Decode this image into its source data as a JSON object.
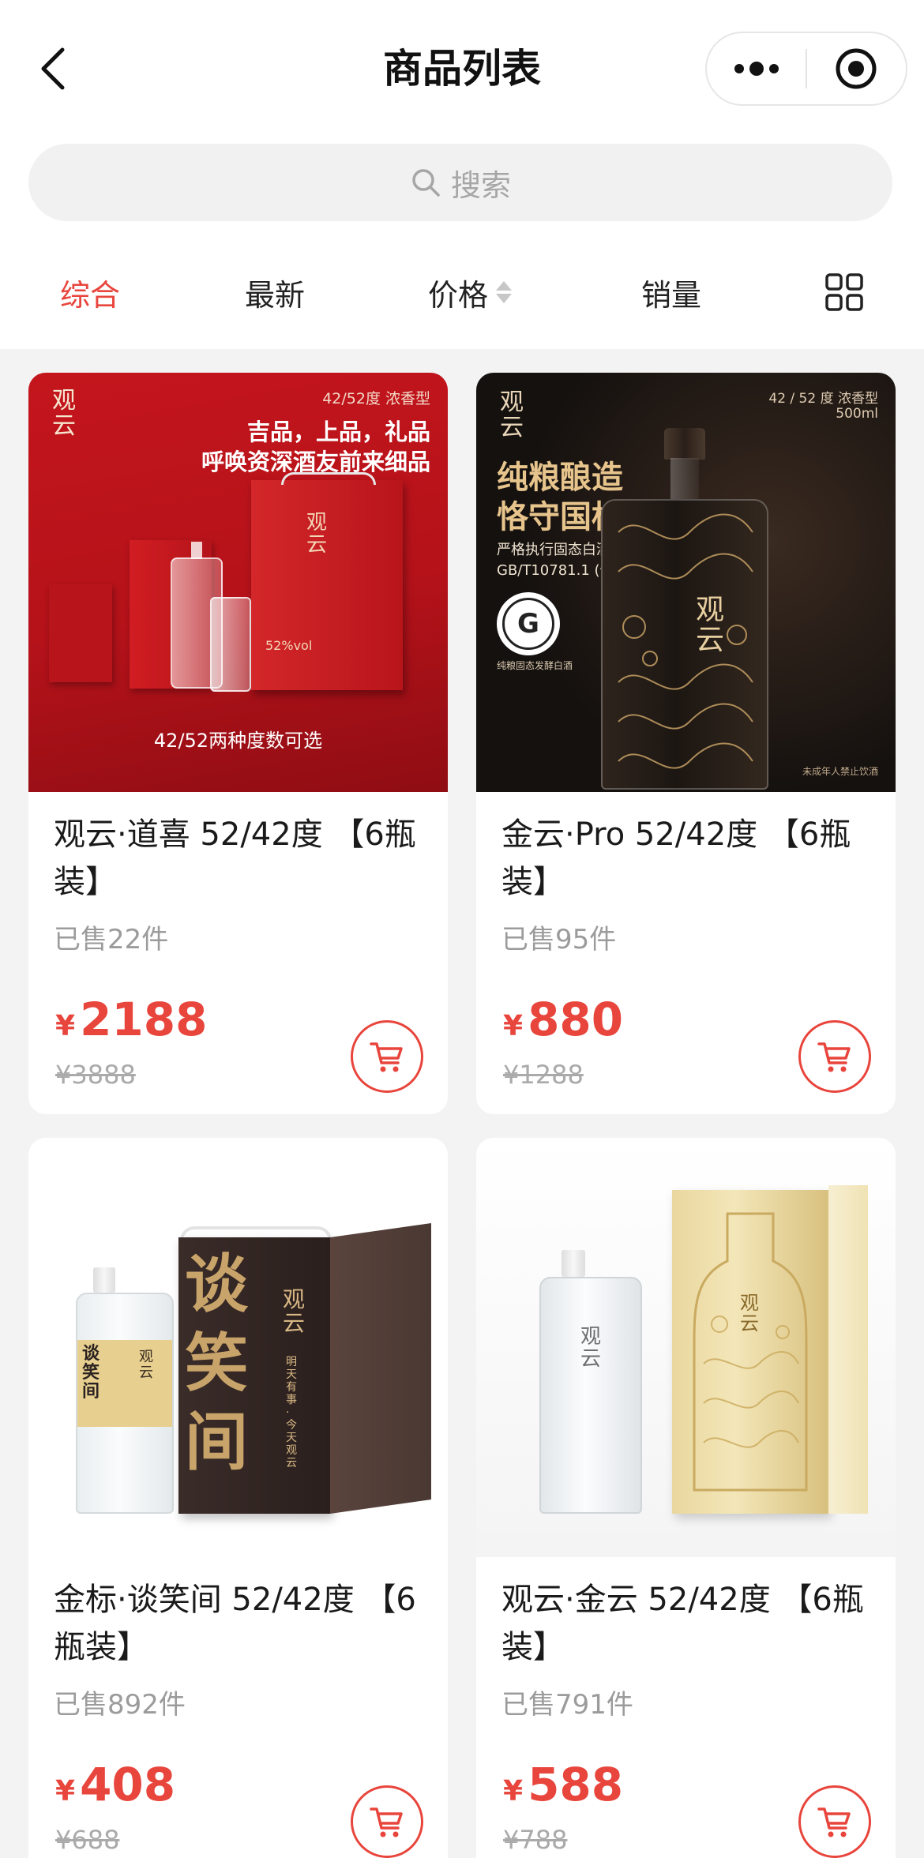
{
  "header": {
    "title": "商品列表",
    "search_placeholder": "搜索"
  },
  "filters": {
    "comprehensive": "综合",
    "newest": "最新",
    "price": "价格",
    "sales": "销量"
  },
  "colors": {
    "accent": "#e8453c",
    "background": "#f3f3f3"
  },
  "products": [
    {
      "name": "观云·道喜 52/42度 【6瓶装】",
      "sold": "已售22件",
      "currency": "¥",
      "price": "2188",
      "original_price": "¥3888",
      "image": {
        "brand": "观云",
        "spec": "42/52度  浓香型",
        "headline_1": "吉品，上品，礼品",
        "headline_2": "呼唤资深酒友前来细品",
        "abv": "52%vol",
        "caption": "42/52两种度数可选"
      }
    },
    {
      "name": "金云·Pro 52/42度 【6瓶装】",
      "sold": "已售95件",
      "currency": "¥",
      "price": "880",
      "original_price": "¥1288",
      "image": {
        "brand": "观云",
        "spec": "42 / 52 度  浓香型",
        "volume": "500ml",
        "headline_1": "纯粮酿造",
        "headline_2": "恪守国标",
        "standard_1": "严格执行固态白酒国标",
        "standard_2": "GB/T10781.1 (优级)",
        "badge_letter": "G",
        "badge_text": "纯粮固态发酵白酒",
        "warning": "未成年人禁止饮酒",
        "bottle_brand": "观云"
      }
    },
    {
      "name": "金标·谈笑间 52/42度 【6瓶装】",
      "sold": "已售892件",
      "currency": "¥",
      "price": "408",
      "original_price": "¥688",
      "image": {
        "box_title": "谈笑间",
        "box_brand": "观云",
        "box_slogan": "明天有事 · 今天观云",
        "label_title": "谈笑间",
        "label_brand": "观云"
      }
    },
    {
      "name": "观云·金云 52/42度 【6瓶装】",
      "sold": "已售791件",
      "currency": "¥",
      "price": "588",
      "original_price": "¥788",
      "image": {
        "bottle_brand": "观云",
        "box_brand": "观云"
      }
    }
  ]
}
